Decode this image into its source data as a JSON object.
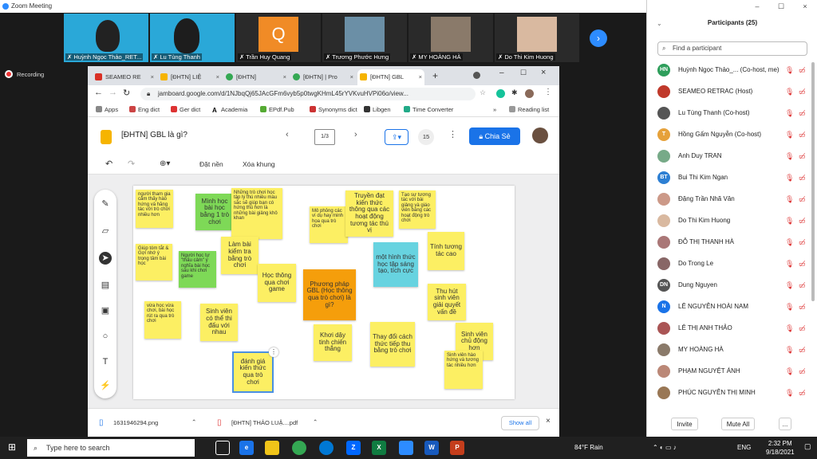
{
  "zoom_title": "Zoom Meeting",
  "recording": "Recording",
  "videos": [
    {
      "name": "Huỳnh Ngọc Thảo_RET...",
      "bg": "#2aa8d8"
    },
    {
      "name": "Lu Tùng Thanh",
      "bg": "#2aa8d8"
    },
    {
      "name": "Trần Huy Quang",
      "bg": "#2a2a2a",
      "initial": "Q"
    },
    {
      "name": "Trương Phước Hưng",
      "bg": "#6b8fa6"
    },
    {
      "name": "MY HOÀNG HÀ",
      "bg": "#8a7a6a"
    },
    {
      "name": "Do Thi Kim Huong",
      "bg": "#d9b9a0"
    }
  ],
  "tabs": [
    "SEAMEO RE",
    "[ĐHTN] LIỆ",
    "[ĐHTN]",
    "[ĐHTN] | Pro",
    "[ĐHTN] GBL"
  ],
  "url": "jamboard.google.com/d/1NJbqQj65JAcGFm6vyb5p0twgKHmL45rYVKvuHVPi06o/view...",
  "bookmarks": [
    "Apps",
    "Eng dict",
    "Ger dict",
    "Academia",
    "EPdf.Pub",
    "Synonyms dict",
    "Libgen",
    "Time Converter",
    "Reading list"
  ],
  "jam": {
    "title": "[ĐHTN] GBL là gì?",
    "frame": "1/3",
    "count": "15",
    "share": "Chia Sẻ",
    "set_bg": "Đặt nền",
    "clear": "Xóa khung"
  },
  "notes": [
    "người tham gia cảm thấy hào hứng và hăng tác với trò chơi nhiều hơn",
    "Mình học bài học bằng 1 trò chơi",
    "Những trò chơi học tập lý thú nhiều màu sắc sẽ giúp bạn có hứng thú hơn là những bài giảng khô khan",
    "Mô phỏng các ví dụ hay minh họa qua trò chơi",
    "Truyền đạt kiến thức thông qua các hoạt động tương tác thú vị",
    "Tạo sự tương tác với bài giảng và giáo viên bằng các hoạt động trò chơi",
    "Giúp tóm tắt & Gợi nhớ ý trọng tâm bài học",
    "Người học tự \"thấu cảm\" ý nghĩa bài học sau khi chơi game",
    "Làm bài kiểm tra bằng trò chơi",
    "Học thông qua chơi game",
    "Phương pháp GBL (Học thông qua trò chơi) là gì?",
    "một hình thức học tập sáng tạo, tích cực",
    "Tính tương tác cao",
    "Thu hút sinh viên giải quyết vấn đề",
    "vừa học vừa chơi, bài học rút ra qua trò chơi",
    "Sinh viên có thể thi đấu với nhau",
    "Khơi dậy tinh chiến thắng",
    "Thay đổi cách thức tiếp thu bằng trò chơi",
    "Sinh viên chủ động hơn",
    "Sinh viên hào hứng và tương tác nhiều hơn",
    "đánh giá kiến thức qua trò chơi"
  ],
  "downloads": [
    "1631946294.png",
    "[ĐHTN] THẢO LUẬ....pdf"
  ],
  "show_all": "Show all",
  "participants_title": "Participants (25)",
  "find_placeholder": "Find a participant",
  "participants": [
    {
      "init": "HN",
      "color": "#2e9e5b",
      "name": "Huỳnh Ngọc Thảo_... (Co-host, me)"
    },
    {
      "init": "",
      "color": "#c0392b",
      "name": "SEAMEO RETRAC (Host)"
    },
    {
      "init": "",
      "color": "#555",
      "name": "Lu Tùng Thanh (Co-host)"
    },
    {
      "init": "T",
      "color": "#e6a13a",
      "name": "Hồng Gấm Nguyễn (Co-host)"
    },
    {
      "init": "",
      "color": "#7a8",
      "name": "Anh Duy TRAN"
    },
    {
      "init": "BT",
      "color": "#2d7fd3",
      "name": "Bui Thi Kim Ngan"
    },
    {
      "init": "",
      "color": "#c98",
      "name": "Đặng Trần Nhã Vân"
    },
    {
      "init": "",
      "color": "#d9b9a0",
      "name": "Do Thi Kim Huong"
    },
    {
      "init": "",
      "color": "#a77",
      "name": "ĐỖ THỊ THANH HÀ"
    },
    {
      "init": "",
      "color": "#866",
      "name": "Do Trong Le"
    },
    {
      "init": "DN",
      "color": "#555",
      "name": "Dung Nguyen"
    },
    {
      "init": "N",
      "color": "#1a73e8",
      "name": "LÊ NGUYỄN HOÀI NAM"
    },
    {
      "init": "",
      "color": "#a55",
      "name": "LÊ THỊ ANH THẢO"
    },
    {
      "init": "",
      "color": "#8a7a6a",
      "name": "MY HOÀNG HÀ"
    },
    {
      "init": "",
      "color": "#b87",
      "name": "PHẠM NGUYỆT ÁNH"
    },
    {
      "init": "",
      "color": "#975",
      "name": "PHÚC NGUYỄN THỊ MINH"
    }
  ],
  "invite": "Invite",
  "mute_all": "Mute All",
  "more": "...",
  "taskbar": {
    "search": "Type here to search",
    "weather": "84°F  Rain",
    "lang": "ENG",
    "time": "2:32 PM",
    "date": "9/18/2021"
  }
}
